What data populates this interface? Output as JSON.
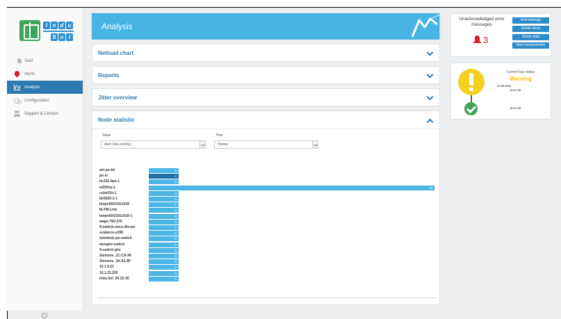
{
  "sidebar": {
    "nav": [
      {
        "label": "Start",
        "icon": "home-icon"
      },
      {
        "label": "Alerts",
        "icon": "bell-icon"
      },
      {
        "label": "Analysis",
        "icon": "chart-icon",
        "active": true
      },
      {
        "label": "Configuration",
        "icon": "gear-icon"
      },
      {
        "label": "Support & Contact",
        "icon": "people-icon"
      }
    ]
  },
  "header": {
    "title": "Analysis"
  },
  "panels": [
    {
      "title": "Netload chart"
    },
    {
      "title": "Reports"
    },
    {
      "title": "Jitter overview"
    },
    {
      "title": "Node statistic"
    }
  ],
  "node_statistic": {
    "value_label": "Value",
    "value_selected": "Alert (low priority)",
    "time_label": "Time",
    "time_selected": "History"
  },
  "chart_data": {
    "type": "bar",
    "orientation": "horizontal",
    "categories": [
      "axl-pn-bk",
      "pn-io",
      "im152-4pn-1",
      "et200sp-1",
      "cube20s-1",
      "bk9103-1-1",
      "bnipnt502102z018",
      "IE-PB-Link",
      "bnipnt502102z018-1",
      "wago-750-370",
      "fl-switch-smcs-8tx-pn",
      "scalance-x208",
      "helmholz-pn-switch",
      "wenglor-switch",
      "fl-switch-ghs",
      "Siemens_1C:CA:46",
      "Siemens_3A:A1:8F",
      "10.1.9.21",
      "10.1.15.255",
      "Indu-Sol_00:22:3C"
    ],
    "values": [
      0,
      0,
      0,
      16,
      0,
      0,
      0,
      0,
      0,
      0,
      0,
      0,
      0,
      0,
      0,
      0,
      0,
      0,
      0,
      0
    ],
    "xlim": [
      0,
      16
    ],
    "highlight_category": "pn-io"
  },
  "alarm": {
    "title": "Unacknowledged error messages",
    "count": "3",
    "buttons": [
      "Acknowledge",
      "Delete alerts",
      "Delete data",
      "New measurement"
    ]
  },
  "bus_status": {
    "label": "Current bus status",
    "state": "Warning",
    "date": "27.05.2016",
    "time1": "15:47:29",
    "time2": "15:47:29"
  }
}
